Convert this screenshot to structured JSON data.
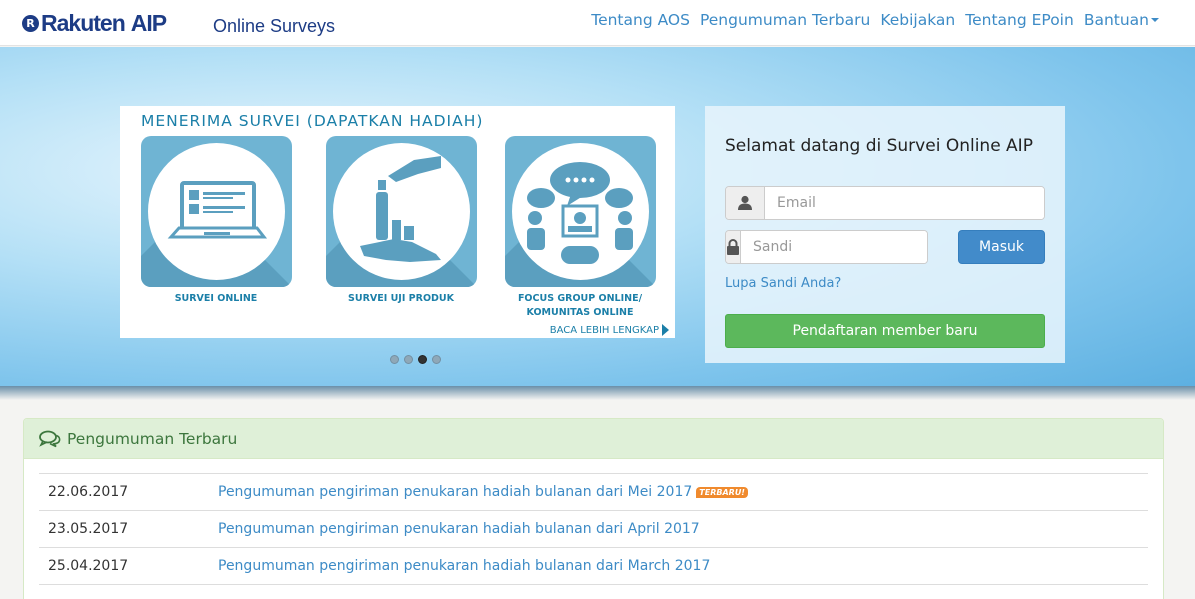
{
  "header": {
    "logo_brand": "Rakuten",
    "logo_product": "AIP",
    "logo_mark": "R",
    "subtitle": "Online Surveys",
    "nav": [
      {
        "label": "Tentang AOS"
      },
      {
        "label": "Pengumuman Terbaru"
      },
      {
        "label": "Kebijakan"
      },
      {
        "label": "Tentang EPoin"
      },
      {
        "label": "Bantuan",
        "dropdown": true
      }
    ]
  },
  "banner": {
    "title": "MENERIMA SURVEI (DAPATKAN HADIAH)",
    "items": [
      {
        "caption": "SURVEI ONLINE",
        "icon": "laptop-icon"
      },
      {
        "caption": "SURVEI UJI PRODUK",
        "icon": "product-hands-icon"
      },
      {
        "caption": "FOCUS GROUP ONLINE/ KOMUNITAS ONLINE",
        "icon": "focus-group-icon"
      }
    ],
    "more_label": "BACA LEBIH LENGKAP",
    "slides": 4,
    "active_slide": 3
  },
  "login": {
    "title": "Selamat datang di Survei Online AIP",
    "email_placeholder": "Email",
    "password_placeholder": "Sandi",
    "submit_label": "Masuk",
    "forgot_label": "Lupa Sandi Anda?",
    "register_label": "Pendaftaran member baru"
  },
  "announcements": {
    "title": "Pengumuman Terbaru",
    "new_badge": "TERBARU!",
    "rows": [
      {
        "date": "22.06.2017",
        "text": "Pengumuman pengiriman penukaran hadiah bulanan dari Mei 2017",
        "is_new": true
      },
      {
        "date": "23.05.2017",
        "text": "Pengumuman pengiriman penukaran hadiah bulanan dari April 2017",
        "is_new": false
      },
      {
        "date": "25.04.2017",
        "text": "Pengumuman pengiriman penukaran hadiah bulanan dari March 2017",
        "is_new": false
      }
    ]
  },
  "colors": {
    "brand": "#1d3c85",
    "link": "#3d8bc6",
    "primary": "#428bca",
    "success": "#5cb85c",
    "banner_accent": "#6fb4d3"
  }
}
